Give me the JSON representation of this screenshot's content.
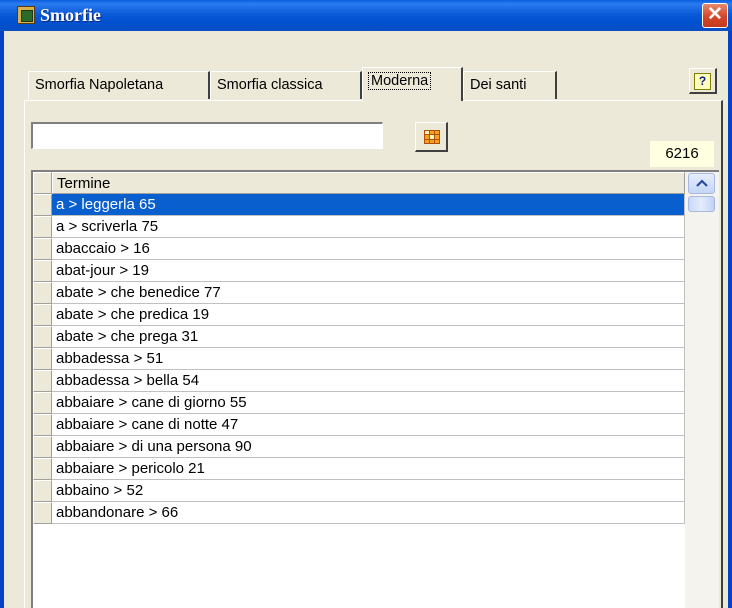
{
  "window": {
    "title": "Smorfie",
    "close_label": "✕"
  },
  "tabs": [
    {
      "label": "Smorfia Napoletana"
    },
    {
      "label": "Smorfia classica"
    },
    {
      "label": "Moderna"
    },
    {
      "label": "Dei santi"
    }
  ],
  "active_tab": "Moderna",
  "help": {
    "label": "?"
  },
  "search": {
    "value": "",
    "placeholder": ""
  },
  "count": "6216",
  "table": {
    "column_header": "Termine",
    "rows": [
      "a > leggerla  65",
      "a > scriverla  75",
      "abaccaio > 16",
      "abat-jour > 19",
      "abate > che benedice  77",
      "abate > che predica  19",
      "abate > che prega 31",
      "abbadessa > 51",
      "abbadessa > bella 54",
      "abbaiare > cane di giorno 55",
      "abbaiare > cane di notte  47",
      "abbaiare > di una persona  90",
      "abbaiare > pericolo  21",
      "abbaino > 52",
      "abbandonare > 66"
    ],
    "selected_row": "a > leggerla  65"
  },
  "colors": {
    "titlebar": "#0a5fe0",
    "selection": "#0a5fce",
    "face": "#ece9d8",
    "badge": "#ffffe1"
  },
  "icons": [
    "app-icon",
    "close-icon",
    "help-icon",
    "grid-icon",
    "scroll-up-arrow-icon"
  ]
}
